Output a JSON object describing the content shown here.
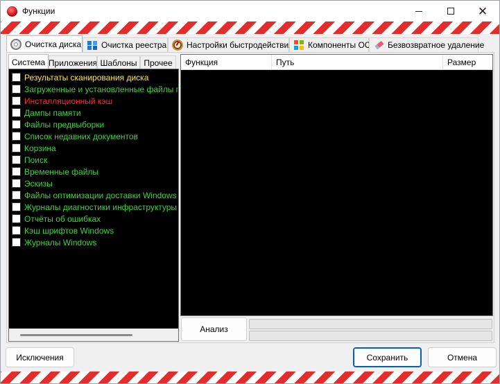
{
  "window": {
    "title": "Функции"
  },
  "tabs": [
    {
      "label": "Очистка диска",
      "icon": "disk-icon",
      "active": true
    },
    {
      "label": "Очистка реестра",
      "icon": "registry-icon",
      "active": false
    },
    {
      "label": "Настройки быстродействия",
      "icon": "speedometer-icon",
      "active": false
    },
    {
      "label": "Компоненты ОС",
      "icon": "windows-logo-icon",
      "active": false
    },
    {
      "label": "Безвозвратное удаление",
      "icon": "eraser-icon",
      "active": false
    }
  ],
  "subtabs": [
    {
      "label": "Система",
      "active": true
    },
    {
      "label": "Приложения",
      "active": false
    },
    {
      "label": "Шаблоны",
      "active": false
    },
    {
      "label": "Прочее",
      "active": false
    }
  ],
  "items": [
    {
      "label": "Результаты сканирования диска",
      "color": "#ffe84a",
      "checked": false
    },
    {
      "label": "Загруженные и установленные файлы программ",
      "color": "#39d639",
      "checked": false
    },
    {
      "label": "Инсталляционный кэш",
      "color": "#ff2a2a",
      "checked": false
    },
    {
      "label": "Дампы памяти",
      "color": "#39d639",
      "checked": false
    },
    {
      "label": "Файлы предвыборки",
      "color": "#39d639",
      "checked": false
    },
    {
      "label": "Список недавних документов",
      "color": "#39d639",
      "checked": false
    },
    {
      "label": "Корзина",
      "color": "#39d639",
      "checked": false
    },
    {
      "label": "Поиск",
      "color": "#39d639",
      "checked": false
    },
    {
      "label": "Временные файлы",
      "color": "#39d639",
      "checked": false
    },
    {
      "label": "Эскизы",
      "color": "#39d639",
      "checked": false
    },
    {
      "label": "Файлы оптимизации доставки Windows",
      "color": "#39d639",
      "checked": false
    },
    {
      "label": "Журналы диагностики инфраструктуры Windows",
      "color": "#39d639",
      "checked": false
    },
    {
      "label": "Отчёты об ошибках",
      "color": "#39d639",
      "checked": false
    },
    {
      "label": "Кэш шрифтов Windows",
      "color": "#39d639",
      "checked": false
    },
    {
      "label": "Журналы Windows",
      "color": "#39d639",
      "checked": false
    }
  ],
  "grid": {
    "columns": [
      "Функция",
      "Путь",
      "Размер"
    ]
  },
  "analyze_label": "Анализ",
  "progress": [
    0,
    0
  ],
  "buttons": {
    "exceptions": "Исключения",
    "save": "Сохранить",
    "cancel": "Отмена"
  }
}
